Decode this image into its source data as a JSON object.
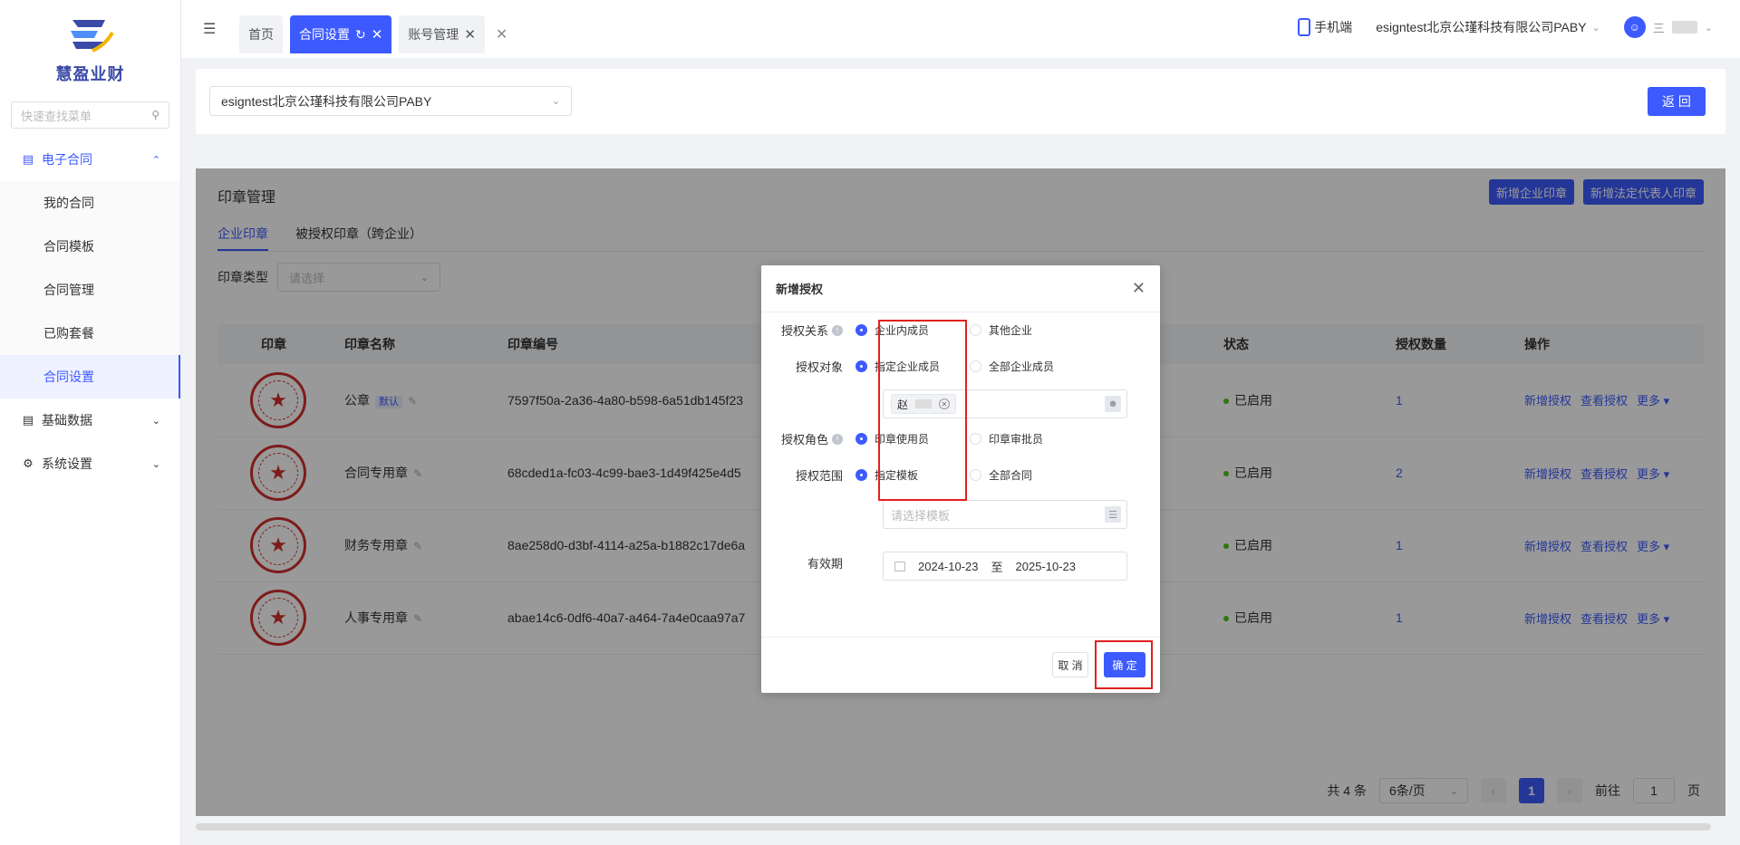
{
  "sidebar": {
    "brand": "慧盈业财",
    "search_placeholder": "快速查找菜单",
    "groups": [
      {
        "label": "电子合同",
        "items": [
          "我的合同",
          "合同模板",
          "合同管理",
          "已购套餐",
          "合同设置"
        ]
      },
      {
        "label": "基础数据"
      },
      {
        "label": "系统设置"
      }
    ]
  },
  "topbar": {
    "tabs": [
      {
        "label": "首页"
      },
      {
        "label": "合同设置"
      },
      {
        "label": "账号管理"
      }
    ],
    "mobile_label": "手机端",
    "company": "esigntest北京公瑾科技有限公司PABY",
    "user_initial": "三"
  },
  "filter": {
    "company": "esigntest北京公瑾科技有限公司PABY",
    "back_label": "返 回"
  },
  "main": {
    "title": "印章管理",
    "btn_add_corp_seal": "新增企业印章",
    "btn_add_legal_seal": "新增法定代表人印章",
    "tabs": [
      "企业印章",
      "被授权印章（跨企业）"
    ],
    "type_label": "印章类型",
    "type_placeholder": "请选择",
    "columns": [
      "印章",
      "印章名称",
      "印章编号",
      "状态",
      "授权数量",
      "操作"
    ],
    "default_badge": "默认",
    "rows": [
      {
        "name": "公章",
        "code": "7597f50a-2a36-4a80-b598-6a51db145f23",
        "status": "已启用",
        "count": "1"
      },
      {
        "name": "合同专用章",
        "code": "68cded1a-fc03-4c99-bae3-1d49f425e4d5",
        "status": "已启用",
        "count": "2"
      },
      {
        "name": "财务专用章",
        "code": "8ae258d0-d3bf-4114-a25a-b1882c17de6a",
        "status": "已启用",
        "count": "1"
      },
      {
        "name": "人事专用章",
        "code": "abae14c6-0df6-40a7-a464-7a4e0caa97a7",
        "status": "已启用",
        "count": "1"
      }
    ],
    "ops": [
      "新增授权",
      "查看授权",
      "更多"
    ],
    "pager": {
      "total": "共 4 条",
      "page_size": "6条/页",
      "current": "1",
      "goto": "前往",
      "goto_value": "1",
      "page_unit": "页"
    }
  },
  "dialog": {
    "title": "新增授权",
    "relation_label": "授权关系",
    "relation_options": [
      "企业内成员",
      "其他企业"
    ],
    "target_label": "授权对象",
    "target_options": [
      "指定企业成员",
      "全部企业成员"
    ],
    "member_tag": "赵",
    "role_label": "授权角色",
    "role_options": [
      "印章使用员",
      "印章审批员"
    ],
    "scope_label": "授权范围",
    "scope_options": [
      "指定模板",
      "全部合同"
    ],
    "template_placeholder": "请选择模板",
    "valid_label": "有效期",
    "date_start": "2024-10-23",
    "date_sep": "至",
    "date_end": "2025-10-23",
    "cancel": "取 消",
    "ok": "确 定"
  }
}
